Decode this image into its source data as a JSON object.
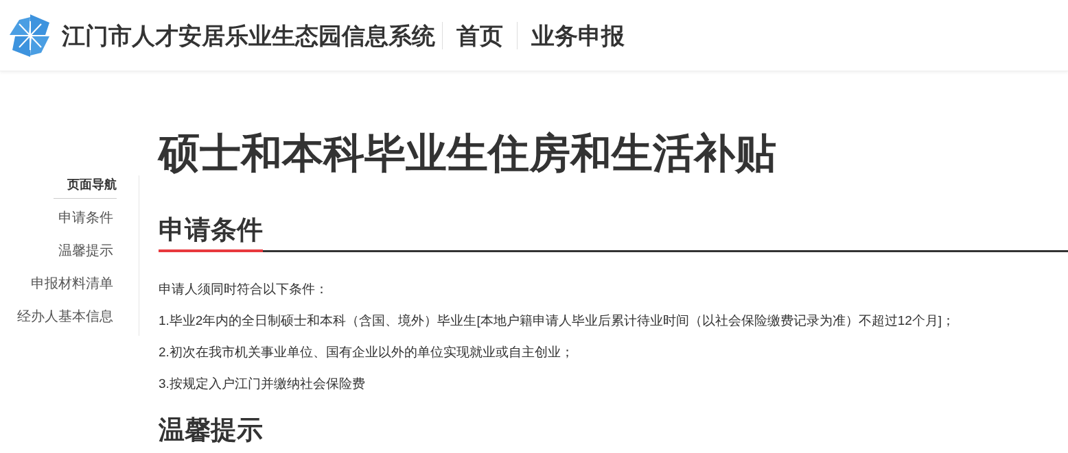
{
  "header": {
    "system_title": "江门市人才安居乐业生态园信息系统",
    "nav": [
      "首页",
      "业务申报"
    ]
  },
  "sidebar": {
    "title": "页面导航",
    "items": [
      "申请条件",
      "温馨提示",
      "申报材料清单",
      "经办人基本信息"
    ]
  },
  "page_title": "硕士和本科毕业生住房和生活补贴",
  "sections": [
    {
      "heading": "申请条件",
      "paragraphs": [
        "申请人须同时符合以下条件：",
        "1.毕业2年内的全日制硕士和本科（含国、境外）毕业生[本地户籍申请人毕业后累计待业时间（以社会保险缴费记录为准）不超过12个月]；",
        "2.初次在我市机关事业单位、国有企业以外的单位实现就业或自主创业；",
        "3.按规定入户江门并缴纳社会保险费"
      ]
    },
    {
      "heading": "温馨提示"
    }
  ]
}
